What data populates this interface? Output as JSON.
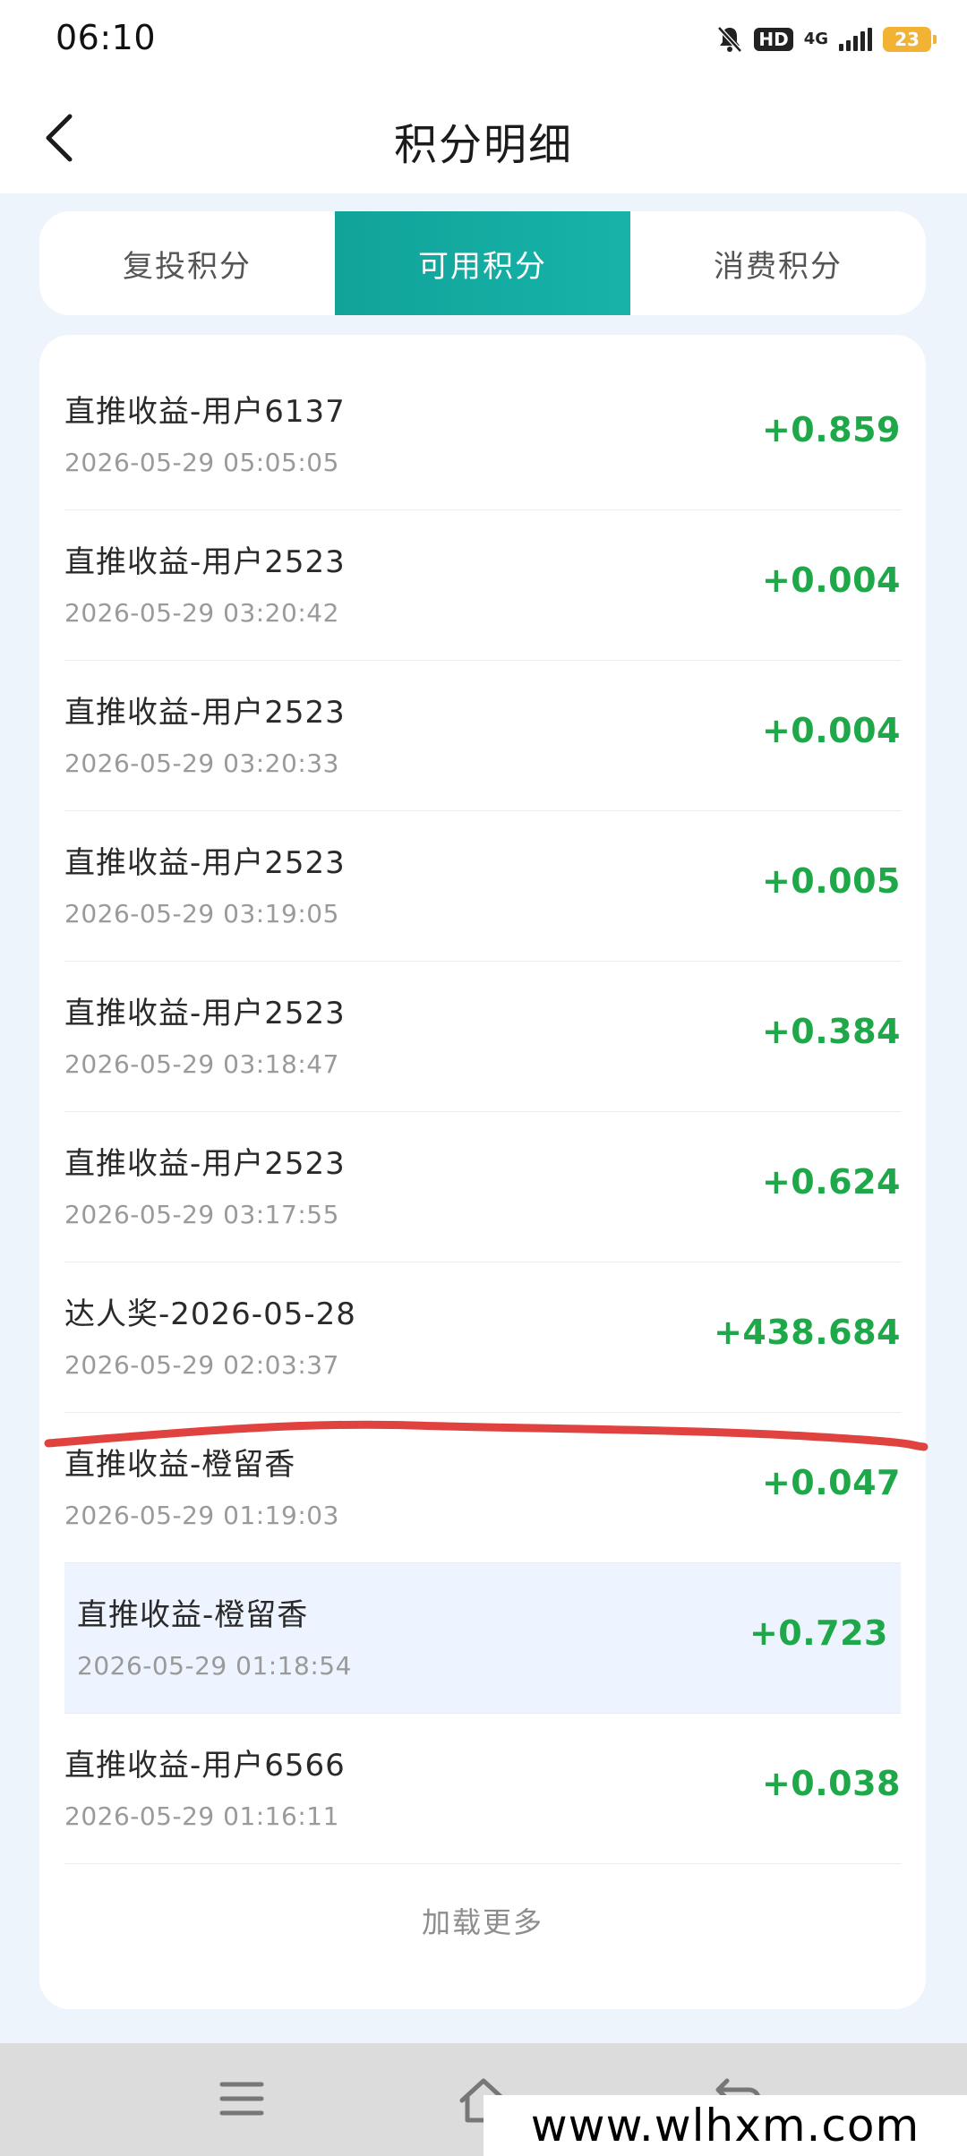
{
  "status_bar": {
    "time": "06:10",
    "hd_label": "HD",
    "network_label": "4G",
    "battery_level": "23",
    "icons": [
      "bell-muted-icon",
      "signal-icon",
      "battery-icon"
    ]
  },
  "header": {
    "title": "积分明细",
    "back_icon": "chevron-left-icon"
  },
  "tabs": [
    {
      "label": "复投积分",
      "active": false
    },
    {
      "label": "可用积分",
      "active": true
    },
    {
      "label": "消费积分",
      "active": false
    }
  ],
  "records": [
    {
      "title": "直推收益-用户6137",
      "time": "2026-05-29 05:05:05",
      "amount": "+0.859"
    },
    {
      "title": "直推收益-用户2523",
      "time": "2026-05-29 03:20:42",
      "amount": "+0.004"
    },
    {
      "title": "直推收益-用户2523",
      "time": "2026-05-29 03:20:33",
      "amount": "+0.004"
    },
    {
      "title": "直推收益-用户2523",
      "time": "2026-05-29 03:19:05",
      "amount": "+0.005"
    },
    {
      "title": "直推收益-用户2523",
      "time": "2026-05-29 03:18:47",
      "amount": "+0.384"
    },
    {
      "title": "直推收益-用户2523",
      "time": "2026-05-29 03:17:55",
      "amount": "+0.624"
    },
    {
      "title": "达人奖-2026-05-28",
      "time": "2026-05-29 02:03:37",
      "amount": "+438.684"
    },
    {
      "title": "直推收益-橙留香",
      "time": "2026-05-29 01:19:03",
      "amount": "+0.047"
    },
    {
      "title": "直推收益-橙留香",
      "time": "2026-05-29 01:18:54",
      "amount": "+0.723"
    },
    {
      "title": "直推收益-用户6566",
      "time": "2026-05-29 01:16:11",
      "amount": "+0.038"
    }
  ],
  "load_more": "加载更多",
  "nav_bar": {
    "icons": [
      "menu-icon",
      "home-icon",
      "back-icon"
    ]
  },
  "watermark": "www.wlhxm.com",
  "colors": {
    "accent": "#13a89e",
    "amount": "#1fa849",
    "annotation": "#e0433f",
    "background": "#eef4fb"
  }
}
